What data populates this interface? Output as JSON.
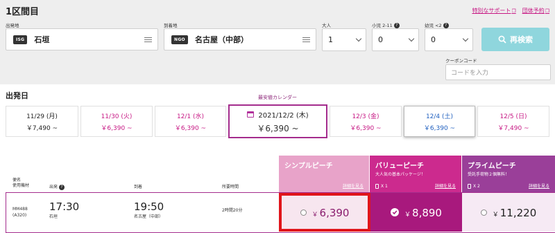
{
  "header": {
    "title": "1区間目",
    "links": [
      {
        "label": "特別なサポート"
      },
      {
        "label": "団体予約"
      }
    ]
  },
  "search": {
    "origin": {
      "label": "出発地",
      "code": "ISG",
      "name": "石垣"
    },
    "destination": {
      "label": "到着地",
      "code": "NGO",
      "name": "名古屋（中部）"
    },
    "adults": {
      "label": "大人",
      "value": "1"
    },
    "children": {
      "label": "小児 2-11",
      "value": "0"
    },
    "infants": {
      "label": "幼児 <2",
      "value": "0"
    },
    "search_button": "再検索",
    "coupon": {
      "label": "クーポンコード",
      "placeholder": "コードを入力"
    }
  },
  "departure": {
    "title": "出発日",
    "calendar_hint": "最安値カレンダー",
    "dates": [
      {
        "date": "11/29 (月)",
        "price": "￥7,490 ~",
        "style": "normal"
      },
      {
        "date": "11/30 (火)",
        "price": "￥6,390 ~",
        "style": "pink"
      },
      {
        "date": "12/1 (水)",
        "price": "￥6,390 ~",
        "style": "pink"
      },
      {
        "date": "2021/12/2 (木)",
        "price": "￥6,390 ~",
        "style": "selected"
      },
      {
        "date": "12/3 (金)",
        "price": "￥6,390 ~",
        "style": "pink"
      },
      {
        "date": "12/4 (土)",
        "price": "￥6,390 ~",
        "style": "blue"
      },
      {
        "date": "12/5 (日)",
        "price": "￥7,490 ~",
        "style": "pink"
      }
    ]
  },
  "fares": {
    "columns": {
      "flight": "便名\n使用機材",
      "departure": "出発",
      "arrival": "到着",
      "duration": "所要時間"
    },
    "types": [
      {
        "name": "シンプルピーチ",
        "subtitle": "",
        "bag": "",
        "link": "詳細を見る",
        "color": "#e8a3c9"
      },
      {
        "name": "バリューピーチ",
        "subtitle": "大人気の基本パッケージ！",
        "bag": "X 1",
        "link": "詳細を見る",
        "color": "#cc2a8e"
      },
      {
        "name": "プライムピーチ",
        "subtitle": "受託手荷物２個無料！",
        "bag": "X 2",
        "link": "詳細を見る",
        "color": "#9a3f99"
      }
    ],
    "flight": {
      "number": "MM488",
      "aircraft": "(A320)",
      "dep_time": "17:30",
      "dep_airport": "石垣",
      "arr_time": "19:50",
      "arr_airport": "名古屋（中部）",
      "duration": "2時間20分",
      "prices": [
        {
          "currency": "￥",
          "amount": "6,390",
          "selected": false
        },
        {
          "currency": "￥",
          "amount": "8,890",
          "selected": true
        },
        {
          "currency": "￥",
          "amount": "11,220",
          "selected": false
        }
      ]
    }
  },
  "highlight_color": "#e0151b"
}
